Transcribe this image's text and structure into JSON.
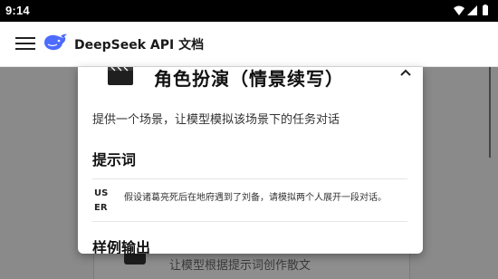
{
  "status_bar": {
    "time": "9:14",
    "icons": [
      "wifi-icon",
      "signal-icon",
      "battery-icon"
    ]
  },
  "app_bar": {
    "title": "DeepSeek API 文档",
    "menu_icon": "hamburger-menu-icon",
    "logo_icon": "deepseek-whale-logo"
  },
  "background": {
    "card_text": "让模型根据提示词创作散文"
  },
  "modal": {
    "icon": "clapperboard-icon",
    "title": "角色扮演（情景续写）",
    "collapse_icon": "chevron-up-icon",
    "description": "提供一个场景，让模型模拟该场景下的任务对话",
    "prompt_heading": "提示词",
    "prompt": {
      "role": "USER",
      "text": "假设诸葛亮死后在地府遇到了刘备，请模拟两个人展开一段对话。"
    },
    "sample_heading": "样例输出"
  },
  "colors": {
    "status_bar": "#000000",
    "app_bar": "#ffffff",
    "backdrop": "#8a8a8a",
    "modal": "#ffffff",
    "brand": "#4d6bfe"
  }
}
